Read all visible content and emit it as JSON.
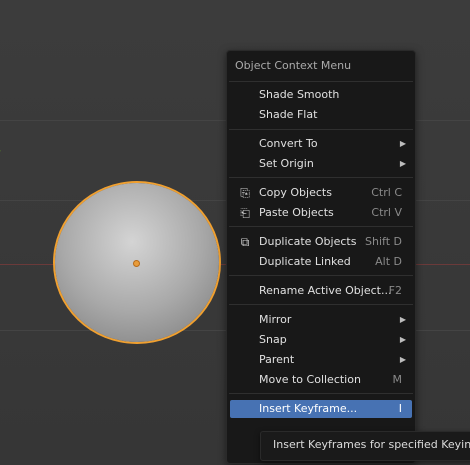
{
  "context_menu": {
    "title": "Object Context Menu",
    "items": [
      {
        "label": "Shade Smooth",
        "shortcut": ""
      },
      {
        "label": "Shade Flat",
        "shortcut": ""
      },
      {
        "label": "Convert To",
        "shortcut": "",
        "submenu": true
      },
      {
        "label": "Set Origin",
        "shortcut": "",
        "submenu": true
      },
      {
        "label": "Copy Objects",
        "shortcut": "Ctrl C",
        "icon": "copy-icon"
      },
      {
        "label": "Paste Objects",
        "shortcut": "Ctrl V",
        "icon": "paste-icon"
      },
      {
        "label": "Duplicate Objects",
        "shortcut": "Shift D",
        "icon": "duplicate-icon"
      },
      {
        "label": "Duplicate Linked",
        "shortcut": "Alt D"
      },
      {
        "label": "Rename Active Object...",
        "shortcut": "F2"
      },
      {
        "label": "Mirror",
        "shortcut": "",
        "submenu": true
      },
      {
        "label": "Snap",
        "shortcut": "",
        "submenu": true
      },
      {
        "label": "Parent",
        "shortcut": "",
        "submenu": true
      },
      {
        "label": "Move to Collection",
        "shortcut": "M"
      },
      {
        "label": "Insert Keyframe...",
        "shortcut": "I",
        "active": true
      }
    ]
  },
  "tooltip": {
    "text": "Insert Keyframes for specified Keying Se"
  },
  "colors": {
    "menu_bg": "#181818",
    "highlight": "#4772b3",
    "selection_outline": "#f0a030"
  }
}
